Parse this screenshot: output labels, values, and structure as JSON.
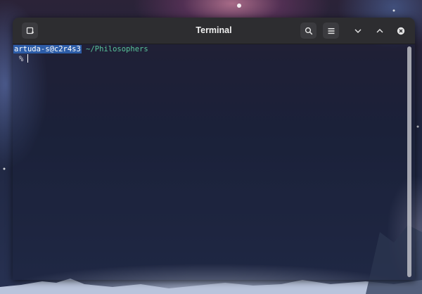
{
  "window": {
    "title": "Terminal"
  },
  "icons": {
    "new_tab": "new-tab-icon",
    "search": "search-icon",
    "menu": "hamburger-menu-icon",
    "minimize": "chevron-down-icon",
    "maximize": "chevron-up-icon",
    "close": "close-icon"
  },
  "terminal": {
    "user_host": "artuda-s@c2r4s3",
    "cwd": "~/Philosophers",
    "prompt_symbol": "%"
  },
  "colors": {
    "headerbar": "#2d2d30",
    "user_highlight": "#2d5da8",
    "cwd_green": "#58c39a"
  }
}
